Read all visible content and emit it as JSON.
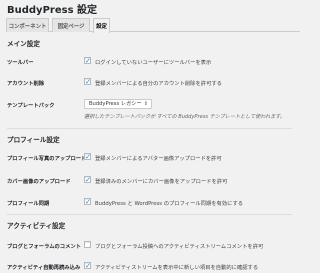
{
  "page_title": "BuddyPress 設定",
  "tabs": [
    {
      "label": "コンポーネント"
    },
    {
      "label": "固定ページ"
    },
    {
      "label": "設定"
    }
  ],
  "sections": {
    "main": {
      "title": "メイン設定",
      "toolbar": {
        "label": "ツールバー",
        "checked": true,
        "text": "ログインしていないユーザーにツールバーを表示"
      },
      "account_delete": {
        "label": "アカウント削除",
        "checked": true,
        "text": "登録メンバーによる自分のアカウント削除を許可する"
      },
      "template_pack": {
        "label": "テンプレートパック",
        "value": "BuddyPress レガシー",
        "description": "選択したテンプレートパックが すべての BuddyPress テンプレートとして使われます。"
      }
    },
    "profile": {
      "title": "プロフィール設定",
      "avatar_upload": {
        "label": "プロフィール写真のアップロード",
        "checked": true,
        "text": "登録メンバーによるアバター画像アップロードを許可"
      },
      "cover_upload": {
        "label": "カバー画像のアップロード",
        "checked": true,
        "text": "登録済みのメンバーにカバー画像をアップロードを許可"
      },
      "profile_sync": {
        "label": "プロフィール同期",
        "checked": true,
        "text": "BuddyPress と WordPress のプロフィール同期を有効にする"
      }
    },
    "activity": {
      "title": "アクティビティ設定",
      "blog_comments": {
        "label": "ブログとフォーラムのコメント",
        "checked": false,
        "text": "ブログとフォーラム投稿へのアクティビティストリームコメントを許可"
      },
      "auto_refresh": {
        "label": "アクティビティ自動再読み込み",
        "checked": true,
        "text": "アクティビティストリームを表示中に新しい項目を自動的に確認する"
      }
    }
  },
  "colors": {
    "background": "#f1f1f1",
    "check": "#1e8cbe"
  }
}
